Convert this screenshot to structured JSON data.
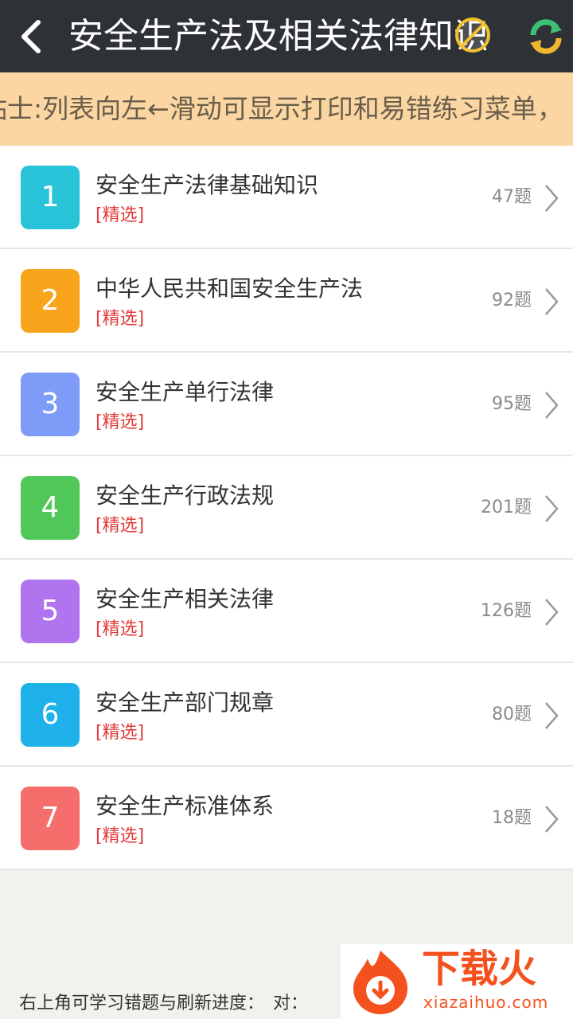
{
  "header": {
    "title": "安全生产法及相关法律知识",
    "back_icon": "back-arrow-icon",
    "ad_icon": "no-ads-icon",
    "refresh_icon": "refresh-icon"
  },
  "tip": {
    "text": "贴士:列表向左←滑动可显示打印和易错练习菜单，"
  },
  "tag_label": "[精选]",
  "items": [
    {
      "num": "1",
      "name": "安全生产法律基础知识",
      "tag": "[精选]",
      "count": "47题",
      "color": "#28c3d8"
    },
    {
      "num": "2",
      "name": "中华人民共和国安全生产法",
      "tag": "[精选]",
      "count": "92题",
      "color": "#f9a51c"
    },
    {
      "num": "3",
      "name": "安全生产单行法律",
      "tag": "[精选]",
      "count": "95题",
      "color": "#7e9cf7"
    },
    {
      "num": "4",
      "name": "安全生产行政法规",
      "tag": "[精选]",
      "count": "201题",
      "color": "#52c759"
    },
    {
      "num": "5",
      "name": "安全生产相关法律",
      "tag": "[精选]",
      "count": "126题",
      "color": "#b074ee"
    },
    {
      "num": "6",
      "name": "安全生产部门规章",
      "tag": "[精选]",
      "count": "80题",
      "color": "#1fb2ea"
    },
    {
      "num": "7",
      "name": "安全生产标准体系",
      "tag": "[精选]",
      "count": "18题",
      "color": "#f56e6c"
    }
  ],
  "footer": {
    "text": "右上角可学习错题与刷新进度：　对："
  },
  "watermark": {
    "cn": "下载火",
    "url": "xiazaihuo.com"
  },
  "colors": {
    "topbar": "#2e3135",
    "tip_bg": "#fbd6a3",
    "tag": "#e33a3a",
    "watermark": "#f5511e"
  }
}
